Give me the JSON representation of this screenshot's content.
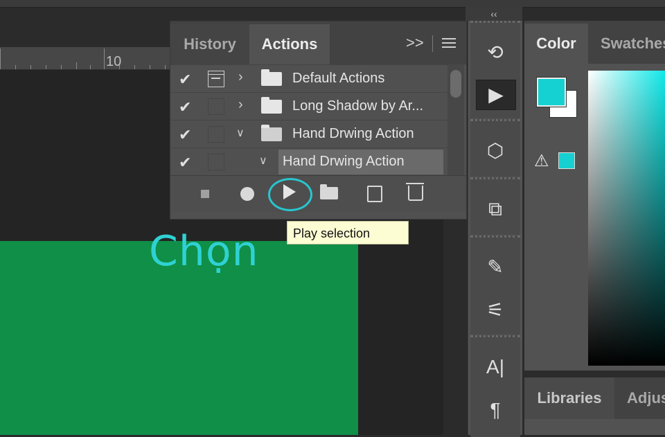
{
  "ruler": {
    "number": "10"
  },
  "canvas": {
    "overlay_text": "Chọn",
    "doc_color": "#0f8f47",
    "text_color": "#2fd1d3"
  },
  "actions_panel": {
    "tabs": [
      {
        "label": "History",
        "active": false
      },
      {
        "label": "Actions",
        "active": true
      }
    ],
    "more_label": ">>",
    "rows": [
      {
        "checked": true,
        "dialog": true,
        "expanded": false,
        "type": "set",
        "label": "Default Actions"
      },
      {
        "checked": true,
        "dialog": false,
        "expanded": false,
        "type": "set",
        "label": "Long Shadow by Ar..."
      },
      {
        "checked": true,
        "dialog": false,
        "expanded": true,
        "type": "set",
        "label": "Hand Drwing Action"
      },
      {
        "checked": true,
        "dialog": false,
        "expanded": true,
        "type": "action",
        "label": "Hand Drwing Action",
        "selected": true
      }
    ],
    "toolbar": [
      "stop-icon",
      "record-icon",
      "play-icon",
      "new-set-icon",
      "new-action-icon",
      "trash-icon"
    ],
    "highlight_color": "#29c6cf"
  },
  "tooltip": {
    "text": "Play selection"
  },
  "tool_strip": {
    "collapse_label": "‹‹",
    "icons": [
      "history-brush-icon",
      "play-icon",
      "3d-icon",
      "transform-icon",
      "brushes-icon",
      "brush-settings-icon",
      "character-icon",
      "paragraph-icon"
    ],
    "glyphs": {
      "character": "A|",
      "paragraph": "¶"
    }
  },
  "color_panel": {
    "tabs": [
      {
        "label": "Color",
        "active": true
      },
      {
        "label": "Swatches",
        "active": false
      }
    ],
    "foreground": "#16d1d1",
    "background": "#ffffff",
    "warning_glyph": "⚠"
  },
  "bottom_panel": {
    "tabs": [
      {
        "label": "Libraries",
        "active": true
      },
      {
        "label": "Adjus",
        "active": false
      }
    ]
  }
}
